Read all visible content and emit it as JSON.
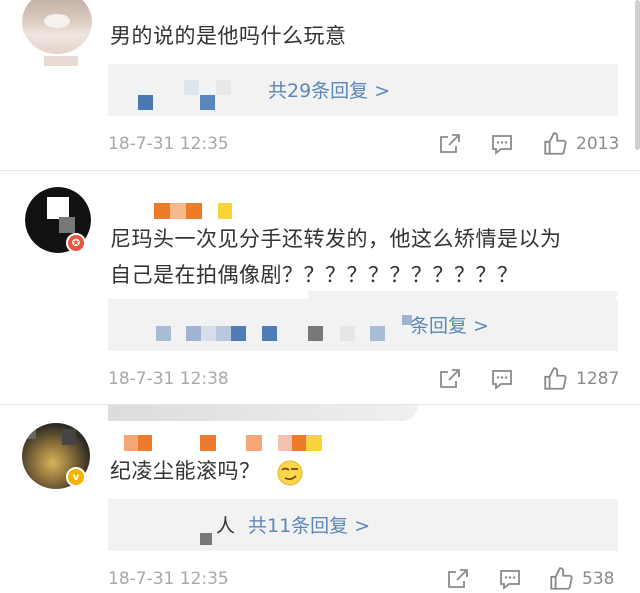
{
  "comments": [
    {
      "text": "男的说的是他吗什么玩意",
      "reply_label": "共29条回复 >",
      "time": "18-7-31 12:35",
      "likes": "2013"
    },
    {
      "text_line1": "尼玛头一次见分手还转发的，他这么矫情是以为",
      "text_line2": "自己是在拍偶像剧？？？？？？？？？？？",
      "reply_label": "条回复 >",
      "time": "18-7-31 12:38",
      "likes": "1287"
    },
    {
      "text": "纪凌尘能滚吗？",
      "reply_prefix": "人",
      "reply_label": "共11条回复 >",
      "time": "18-7-31 12:35",
      "likes": "538"
    }
  ],
  "icons": {
    "share": "share-icon",
    "comment": "comment-icon",
    "like": "thumbs-up-icon",
    "emoji": "smirk-emoji"
  },
  "colors": {
    "link": "#5b86b8",
    "meta": "#a8a8a8",
    "reply_bg": "#f2f2f2"
  }
}
